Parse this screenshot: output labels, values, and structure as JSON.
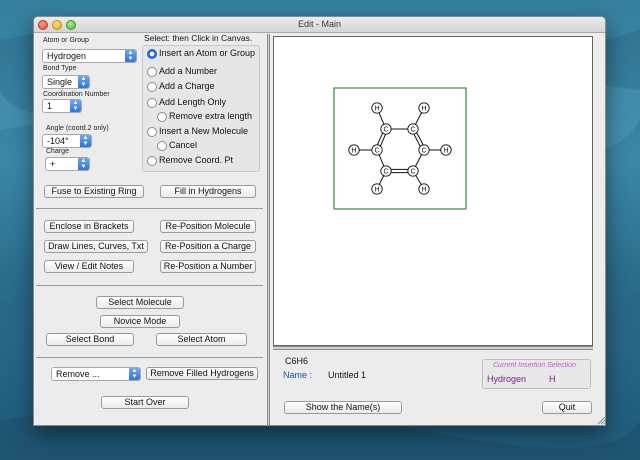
{
  "window": {
    "title": "Edit - Main"
  },
  "left": {
    "atom_group_label": "Atom or Group",
    "atom_group_value": "Hydrogen",
    "bond_type_label": "Bond Type",
    "bond_type_value": "Single",
    "coord_label": "Coordination Number",
    "coord_value": "1",
    "angle_label": "Angle (coord.2 only)",
    "angle_value": "-104°",
    "charge_label": "Charge",
    "charge_value": "+",
    "radio_heading": "Select: then Click in Canvas.",
    "radios": [
      "Insert an Atom or Group",
      "Add a Number",
      "Add a Charge",
      "Add Length Only",
      "Remove extra length",
      "Insert a New Molecule",
      "Cancel",
      "Remove Coord. Pt"
    ],
    "fuse_label": "Fuse to Existing Ring",
    "fill_hydrogens": "Fill in Hydrogens",
    "enclose_brackets": "Enclose in Brackets",
    "reposition_molecule": "Re-Position Molecule",
    "draw_lines": "Draw Lines, Curves, Txt",
    "reposition_charge": "Re-Position a Charge",
    "view_notes": "View / Edit Notes",
    "reposition_number": "Re-Position a Number",
    "select_molecule": "Select Molecule",
    "novice_mode": "Novice Mode",
    "select_bond": "Select Bond",
    "select_atom": "Select Atom",
    "remove_value": "Remove ...",
    "remove_filled": "Remove Filled Hydrogens",
    "start_over": "Start Over"
  },
  "right": {
    "molecule": {
      "atoms": [
        "H",
        "H",
        "H",
        "H",
        "H",
        "H",
        "C",
        "C",
        "C",
        "C",
        "C",
        "C"
      ]
    },
    "formula": "C6H6",
    "name_label": "Name :",
    "name_value": "Untitled 1",
    "insertion_title": "Current Insertion Selection",
    "insertion_name": "Hydrogen",
    "insertion_symbol": "H",
    "show_name": "Show the Name(s)",
    "quit": "Quit"
  }
}
